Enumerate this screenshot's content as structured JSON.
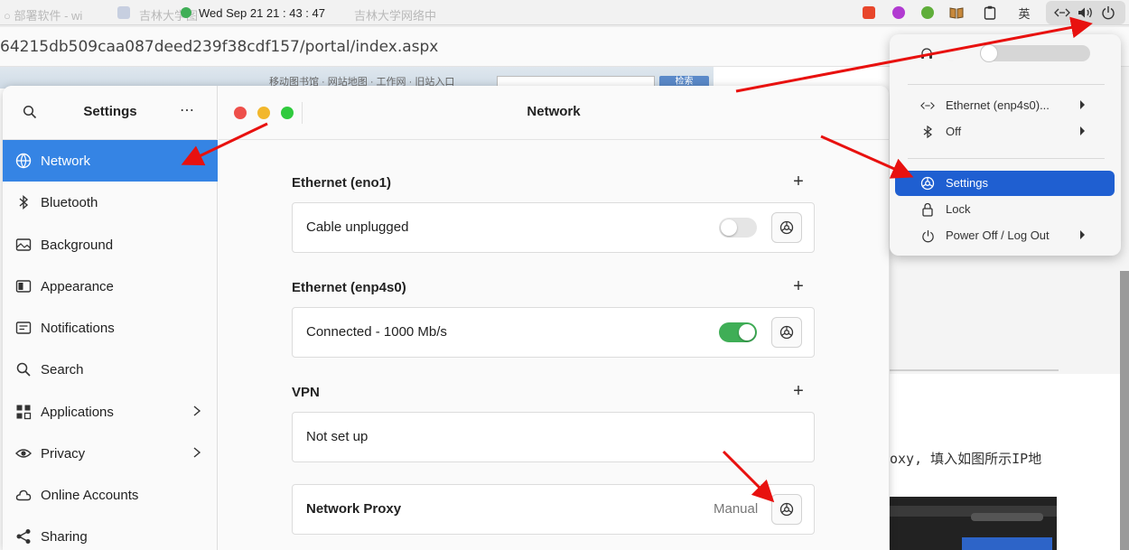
{
  "topbar": {
    "ghost_left": "○ 部署软件 - wi",
    "ghost_mid": "吉林大学图",
    "ghost_right": "吉林大学网络中",
    "clock": "Wed Sep 21  21 : 43 : 47",
    "ime": "英",
    "tray_colors": {
      "red": "#e8462b",
      "purple": "#b13bd1",
      "green": "#5fae3a",
      "book": "#c8893c"
    }
  },
  "browser": {
    "url": "64215db509caa087deed239f38cdf157/portal/index.aspx",
    "strip_links": "移动图书馆 · 网站地图 · 工作网 · 旧站入口",
    "strip_button": "检索",
    "right_text": "oxy, 填入如图所示IP地"
  },
  "sidebar": {
    "title": "Settings",
    "more": "⋯",
    "items": [
      {
        "label": "Network",
        "icon": "network-icon",
        "active": true
      },
      {
        "label": "Bluetooth",
        "icon": "bluetooth-icon"
      },
      {
        "label": "Background",
        "icon": "background-icon"
      },
      {
        "label": "Appearance",
        "icon": "appearance-icon"
      },
      {
        "label": "Notifications",
        "icon": "notifications-icon"
      },
      {
        "label": "Search",
        "icon": "search-icon"
      },
      {
        "label": "Applications",
        "icon": "applications-icon",
        "chevron": true
      },
      {
        "label": "Privacy",
        "icon": "privacy-icon",
        "chevron": true
      },
      {
        "label": "Online Accounts",
        "icon": "online-accounts-icon"
      },
      {
        "label": "Sharing",
        "icon": "sharing-icon"
      }
    ]
  },
  "main": {
    "title": "Network",
    "sections": [
      {
        "title": "Ethernet (eno1)",
        "status": "Cable unplugged",
        "toggle": false
      },
      {
        "title": "Ethernet (enp4s0)",
        "status": "Connected - 1000 Mb/s",
        "toggle": true
      },
      {
        "title": "VPN",
        "status": "Not set up"
      }
    ],
    "proxy": {
      "label": "Network Proxy",
      "value": "Manual"
    }
  },
  "menu": {
    "volume_level": 0.3,
    "items": [
      {
        "label": "Ethernet (enp4s0)...",
        "icon": "ethernet-icon",
        "arrow": true
      },
      {
        "label": "Off",
        "icon": "bluetooth-icon",
        "arrow": true
      },
      {
        "label": "Settings",
        "icon": "settings-icon",
        "active": true
      },
      {
        "label": "Lock",
        "icon": "lock-icon"
      },
      {
        "label": "Power Off / Log Out",
        "icon": "power-icon",
        "arrow": true
      }
    ]
  },
  "colors": {
    "accent": "#3584e4",
    "menu_active": "#1f5fd1",
    "toggle_on": "#3fae56",
    "annotation": "#e8110f"
  }
}
